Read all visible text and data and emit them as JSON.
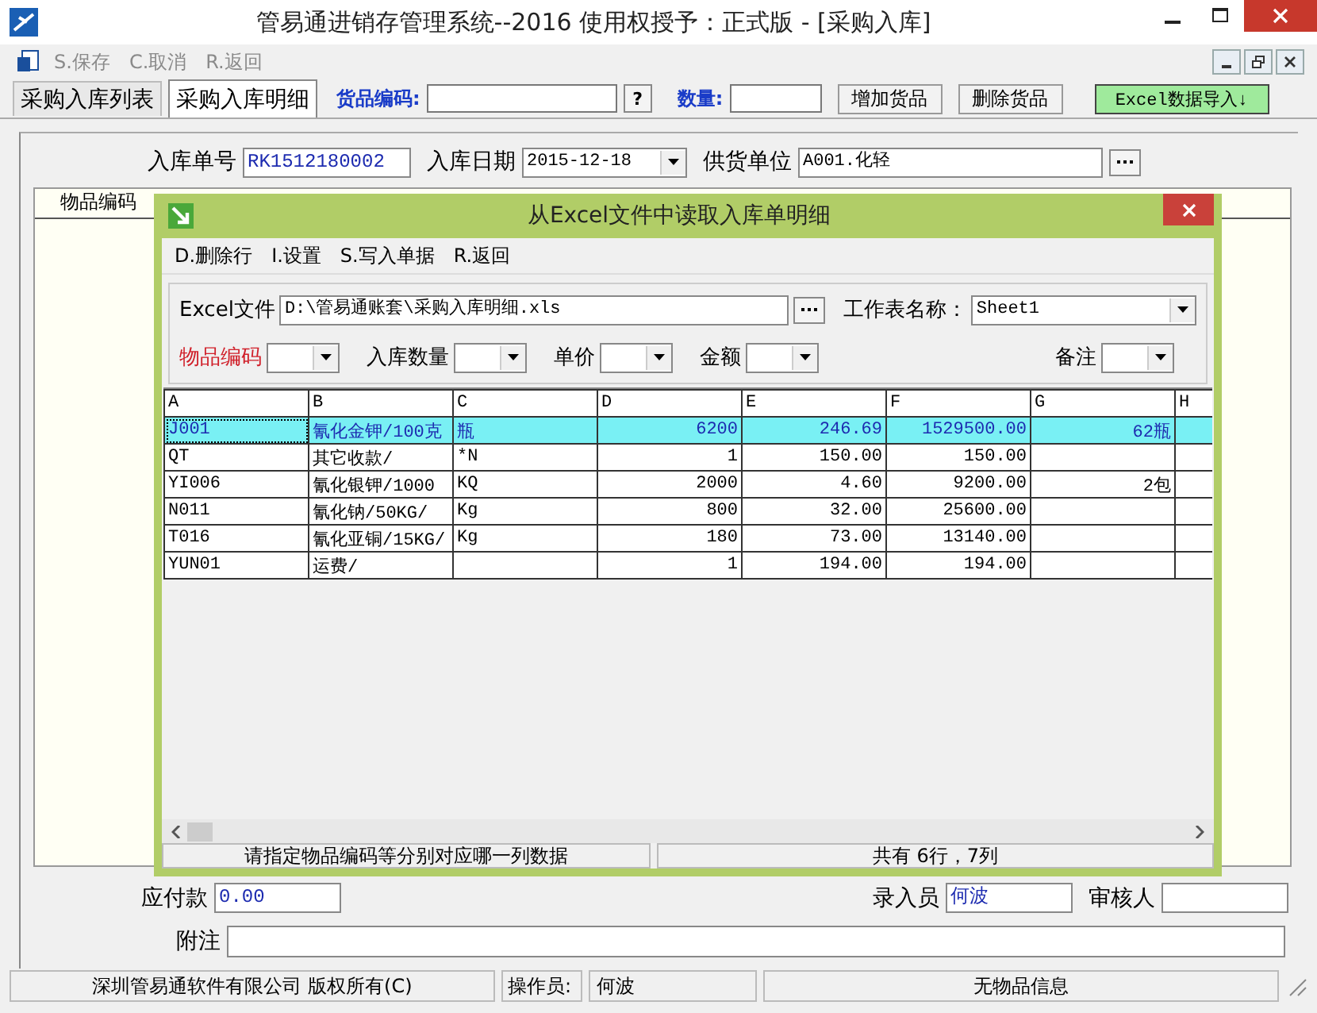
{
  "window": {
    "title": "管易通进销存管理系统--2016  使用权授予：正式版 - [采购入库]"
  },
  "menu": [
    {
      "label": "S.保存",
      "disabled": true
    },
    {
      "label": "C.取消",
      "disabled": true
    },
    {
      "label": "R.返回",
      "disabled": true
    }
  ],
  "tabs": [
    {
      "label": "采购入库列表",
      "selected": false
    },
    {
      "label": "采购入库明细",
      "selected": true
    }
  ],
  "toolbar": {
    "code_label": "货品编码:",
    "lookup_button": "?",
    "qty_label": "数量:",
    "buttons": [
      "增加货品",
      "删除货品"
    ],
    "import_button": "Excel数据导入↓"
  },
  "form": {
    "fields": [
      {
        "label": "入库单号",
        "value": "RK1512180002",
        "kind": "text"
      },
      {
        "label": "入库日期",
        "value": "2015-12-18",
        "kind": "combo"
      },
      {
        "label": "供货单位",
        "value": "A001.化轻",
        "kind": "lookup"
      }
    ]
  },
  "grid": {
    "columns": [
      "物品编码"
    ]
  },
  "bottom_fields": [
    {
      "label": "应付款",
      "value": "0.00"
    },
    {
      "label": "录入员",
      "value": "何波"
    },
    {
      "label": "审核人"
    }
  ],
  "remark": {
    "label": "附注"
  },
  "dialog": {
    "title": "从Excel文件中读取入库单明细",
    "menu": [
      "D.删除行",
      "I.设置",
      "S.写入单据",
      "R.返回"
    ],
    "file_label": "Excel文件",
    "file_value": "D:\\管易通账套\\采购入库明细.xls",
    "sheet_label": "工作表名称：",
    "sheet_value": "Sheet1",
    "mappings": [
      {
        "label": "物品编码",
        "required": true
      },
      {
        "label": "入库数量",
        "required": false
      },
      {
        "label": "单价",
        "required": false
      },
      {
        "label": "金额",
        "required": false
      },
      {
        "label": "备注",
        "required": false
      }
    ],
    "table": {
      "columns": [
        "A",
        "B",
        "C",
        "D",
        "E",
        "F",
        "G",
        "H"
      ],
      "rows": [
        {
          "selected": true,
          "cells": [
            "J001",
            "氰化金钾/100克",
            "瓶",
            "6200",
            "246.69",
            "1529500.00",
            "62瓶",
            null
          ]
        },
        {
          "selected": false,
          "cells": [
            "QT",
            "其它收款/",
            "*N",
            "1",
            "150.00",
            "150.00",
            null,
            null
          ]
        },
        {
          "selected": false,
          "cells": [
            "YI006",
            "氰化银钾/1000",
            "KQ",
            "2000",
            "4.60",
            "9200.00",
            "2包",
            null
          ]
        },
        {
          "selected": false,
          "cells": [
            "N011",
            "氰化钠/50KG/",
            "Kg",
            "800",
            "32.00",
            "25600.00",
            null,
            null
          ]
        },
        {
          "selected": false,
          "cells": [
            "T016",
            "氰化亚铜/15KG/",
            "Kg",
            "180",
            "73.00",
            "13140.00",
            null,
            null
          ]
        },
        {
          "selected": false,
          "cells": [
            "YUN01",
            "运费/",
            null,
            "1",
            "194.00",
            "194.00",
            null,
            null
          ]
        }
      ]
    },
    "status": [
      "请指定物品编码等分别对应哪一列数据",
      "共有 6行，7列"
    ]
  },
  "status_bar": [
    "深圳管易通软件有限公司 版权所有(C)",
    "操作员:",
    "何波",
    "无物品信息"
  ]
}
